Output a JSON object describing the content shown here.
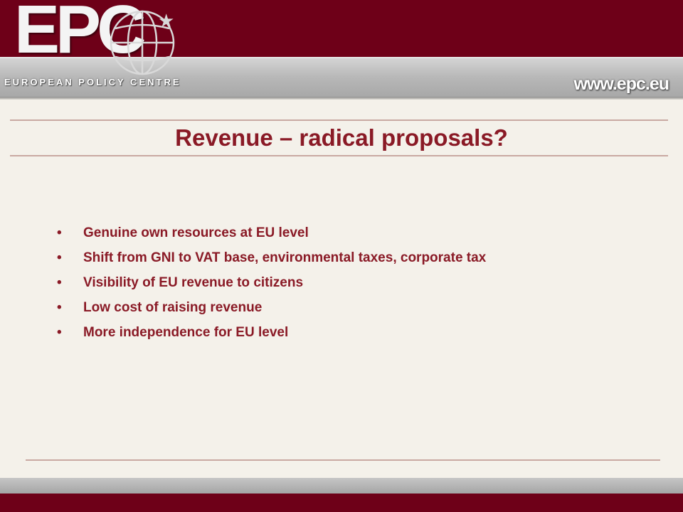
{
  "header": {
    "logo": "EPC",
    "tagline": "EUROPEAN POLICY CENTRE",
    "website": "www.epc.eu"
  },
  "slide": {
    "title": "Revenue – radical proposals?",
    "bullets": [
      "Genuine own resources at EU level",
      "Shift from GNI to VAT base, environmental taxes, corporate tax",
      "Visibility of EU revenue to citizens",
      "Low cost of raising revenue",
      "More independence for EU level"
    ],
    "bullet_marker": "•"
  },
  "colors": {
    "brand_maroon": "#6e0018",
    "text_red": "#8a1a26",
    "background": "#f4f1ea"
  }
}
